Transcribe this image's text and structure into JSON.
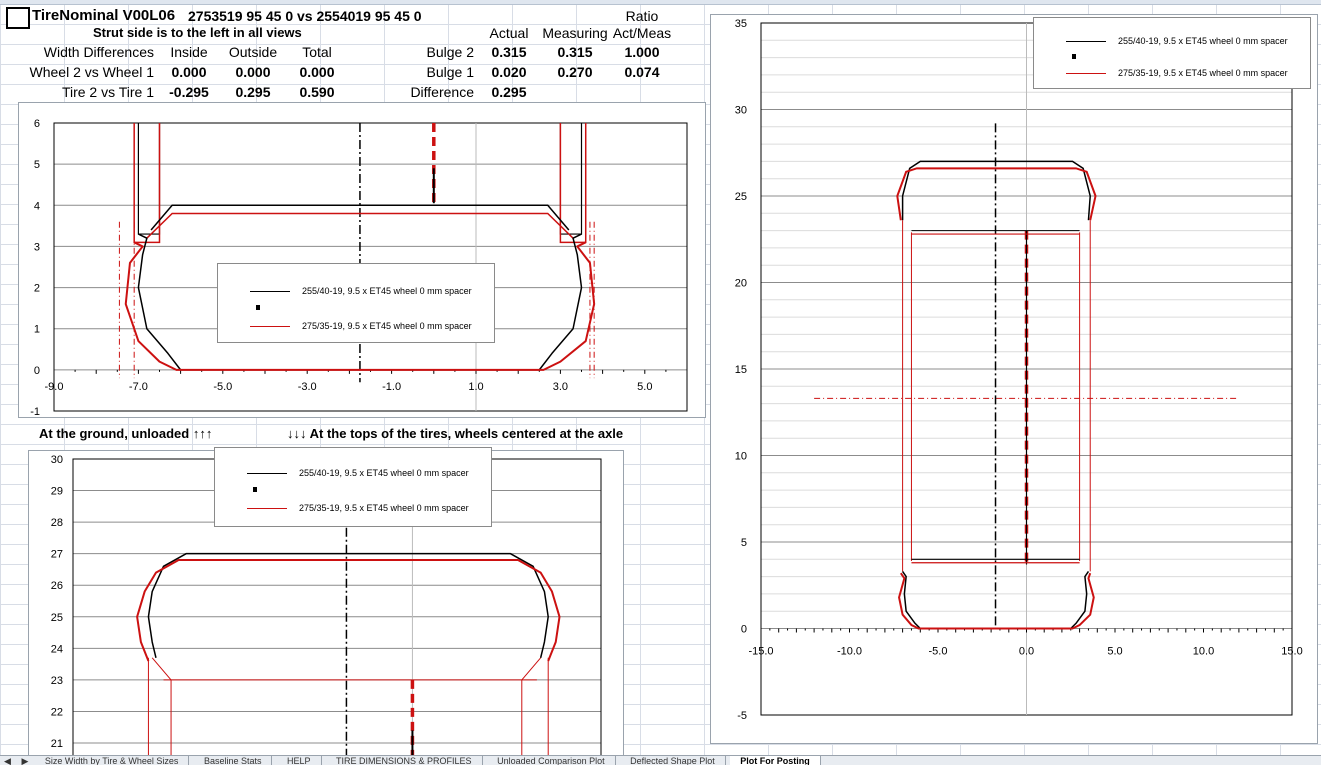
{
  "header": {
    "title": "TireNominal V00L06",
    "compare": "2753519 95 45 0 vs  2554019 95 45 0",
    "strut_note": "Strut side is to the left in all views"
  },
  "table": {
    "ratio_label": "Ratio",
    "col_actual": "Actual",
    "col_measuring": "Measuring",
    "col_actmeas": "Act/Meas",
    "width_diff_label": "Width Differences",
    "col_inside": "Inside",
    "col_outside": "Outside",
    "col_total": "Total",
    "rows": [
      {
        "label": "Wheel 2 vs Wheel 1",
        "inside": "0.000",
        "outside": "0.000",
        "total": "0.000"
      },
      {
        "label": "Tire 2 vs Tire 1",
        "inside": "-0.295",
        "outside": "0.295",
        "total": "0.590"
      }
    ],
    "bulge": [
      {
        "label": "Bulge 2",
        "actual": "0.315",
        "measuring": "0.315",
        "ratio": "1.000"
      },
      {
        "label": "Bulge 1",
        "actual": "0.020",
        "measuring": "0.270",
        "ratio": "0.074"
      },
      {
        "label": "Difference",
        "actual": "0.295"
      }
    ]
  },
  "captions": {
    "ground": "At the ground, unloaded ↑↑↑",
    "tops": "↓↓↓ At the tops of the tires, wheels centered at the axle"
  },
  "legend": {
    "series1": "255/40-19, 9.5 x ET45 wheel 0 mm spacer",
    "series2": "275/35-19, 9.5 x ET45 wheel 0 mm spacer"
  },
  "colors": {
    "series1": "#000000",
    "series2": "#cc1111"
  },
  "chart_data": [
    {
      "type": "line",
      "view": "ground",
      "xlim": [
        -9,
        6
      ],
      "ylim": [
        -1,
        6
      ],
      "x_ticks": [
        -9.0,
        -7.0,
        -5.0,
        -3.0,
        -1.0,
        1.0,
        3.0,
        5.0
      ],
      "y_ticks": [
        -1,
        0,
        1,
        2,
        3,
        4,
        5,
        6
      ],
      "series": [
        {
          "name": "255/40-19, 9.5 x ET45 wheel 0 mm spacer",
          "color": "#000000",
          "profile": [
            [
              -7.0,
              3.3
            ],
            [
              -6.8,
              3.2
            ],
            [
              -6.9,
              2.8
            ],
            [
              -7.0,
              2.0
            ],
            [
              -6.8,
              1.0
            ],
            [
              -6.3,
              0.4
            ],
            [
              -6.0,
              0.0
            ],
            [
              2.5,
              0.0
            ],
            [
              2.8,
              0.4
            ],
            [
              3.3,
              1.0
            ],
            [
              3.5,
              2.0
            ],
            [
              3.4,
              2.8
            ],
            [
              3.3,
              3.2
            ],
            [
              3.5,
              3.3
            ]
          ]
        },
        {
          "name": "275/35-19, 9.5 x ET45 wheel 0 mm spacer",
          "color": "#cc1111",
          "profile": [
            [
              -7.1,
              3.1
            ],
            [
              -6.9,
              3.0
            ],
            [
              -7.2,
              2.6
            ],
            [
              -7.3,
              1.6
            ],
            [
              -7.0,
              0.7
            ],
            [
              -6.5,
              0.2
            ],
            [
              -6.1,
              0.0
            ],
            [
              2.6,
              0.0
            ],
            [
              3.0,
              0.2
            ],
            [
              3.6,
              0.7
            ],
            [
              3.8,
              1.6
            ],
            [
              3.7,
              2.6
            ],
            [
              3.4,
              3.0
            ],
            [
              3.6,
              3.1
            ]
          ]
        }
      ]
    },
    {
      "type": "line",
      "view": "tops",
      "xlim": [
        -9,
        5
      ],
      "ylim": [
        21,
        30
      ],
      "y_ticks": [
        21,
        22,
        23,
        24,
        25,
        26,
        27,
        28,
        29,
        30
      ],
      "series": [
        {
          "name": "255/40-19, 9.5 x ET45 wheel 0 mm spacer",
          "color": "#000000",
          "profile": [
            [
              -6.8,
              23.7
            ],
            [
              -6.9,
              24.2
            ],
            [
              -7.0,
              25.0
            ],
            [
              -6.9,
              25.8
            ],
            [
              -6.6,
              26.6
            ],
            [
              -6.0,
              27.0
            ],
            [
              2.6,
              27.0
            ],
            [
              3.2,
              26.6
            ],
            [
              3.5,
              25.8
            ],
            [
              3.6,
              25.0
            ],
            [
              3.5,
              24.2
            ],
            [
              3.4,
              23.7
            ]
          ]
        },
        {
          "name": "275/35-19, 9.5 x ET45 wheel 0 mm spacer",
          "color": "#cc1111",
          "profile": [
            [
              -7.0,
              23.6
            ],
            [
              -7.2,
              24.2
            ],
            [
              -7.3,
              25.0
            ],
            [
              -7.1,
              25.8
            ],
            [
              -6.8,
              26.4
            ],
            [
              -6.2,
              26.8
            ],
            [
              2.8,
              26.8
            ],
            [
              3.4,
              26.4
            ],
            [
              3.7,
              25.8
            ],
            [
              3.9,
              25.0
            ],
            [
              3.8,
              24.2
            ],
            [
              3.6,
              23.6
            ]
          ]
        }
      ]
    },
    {
      "type": "line",
      "view": "side",
      "xlim": [
        -15,
        15
      ],
      "ylim": [
        -5,
        35
      ],
      "x_ticks": [
        -15.0,
        -10.0,
        -5.0,
        0.0,
        5.0,
        10.0,
        15.0
      ],
      "y_ticks": [
        -5,
        0,
        5,
        10,
        15,
        20,
        25,
        30,
        35
      ],
      "series": [
        {
          "name": "255/40-19, 9.5 x ET45 wheel 0 mm spacer",
          "color": "#000000"
        },
        {
          "name": "275/35-19, 9.5 x ET45 wheel 0 mm spacer",
          "color": "#cc1111"
        }
      ]
    }
  ],
  "sheet_tabs": [
    "Size Width by Tire & Wheel Sizes",
    "Baseline Stats",
    "HELP",
    "TIRE DIMENSIONS & PROFILES",
    "Unloaded Comparison Plot",
    "Deflected Shape Plot",
    "Plot For Posting"
  ],
  "active_tab": "Plot For Posting"
}
